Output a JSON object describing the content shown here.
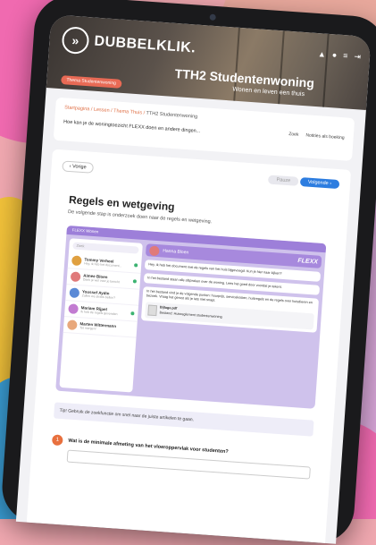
{
  "brand": {
    "name": "DUBBELKLIK."
  },
  "header": {
    "title": "TTH2 Studentenwoning",
    "subtitle": "Wonen en leven een thuis",
    "badge": "Thema Studentenwoning",
    "icons": [
      "bell-icon",
      "user-icon",
      "menu-icon",
      "logout-icon"
    ]
  },
  "breadcrumb": {
    "items": [
      "Startpagina",
      "Lessen",
      "Thema Thuis",
      "TTH2 Studentenwoning"
    ]
  },
  "lesson": {
    "question": "Hoe kan je de woningtoezicht FLEXX doen en andere dingen...",
    "actions": [
      "Zoek",
      "Notities als boeking"
    ]
  },
  "nav": {
    "prev_label": "Vorige",
    "pause_label": "Pauze",
    "next_label": "Volgende"
  },
  "section": {
    "title": "Regels en wetgeving",
    "subtitle": "De volgende stap is onderzoek doen naar de regels en wetgeving."
  },
  "app": {
    "top_label": "FLEXX Wonen",
    "search_placeholder": "Zoek",
    "brand": "FLEXX",
    "chat_name": "Hanna Bloen",
    "contacts": [
      {
        "name": "Tommy Verheel",
        "msg": "Hey, ik heb het document...",
        "color": "#e0a040"
      },
      {
        "name": "Aimee Bloen",
        "msg": "Dank je wel voor je bericht",
        "color": "#e07a7a"
      },
      {
        "name": "Youssef Aydin",
        "msg": "Zullen we straks bellen?",
        "color": "#5b8ad6"
      },
      {
        "name": "Mariam Rijpel",
        "msg": "Ik heb de regels gevonden",
        "color": "#c27bd1"
      },
      {
        "name": "Marten Wittermann",
        "msg": "Tot morgen!",
        "color": "#e8a87c"
      }
    ],
    "messages": [
      "Hey, ik heb het document met de regels van het huis bijgevoegd. Kun je hier naar kijken?",
      "In het bestand staan alle afspraken over de woning. Lees het goed door voordat je tekent.",
      "In het bestand vind je de volgende punten: huurprijs, servicekosten, huisregels en de regels over huisdieren en bezoek. Vraag het gerust als je iets niet snapt."
    ],
    "file": {
      "name": "Bijlage.pdf",
      "desc": "Bestand: Huisreglement studentenwoning"
    }
  },
  "tip": "Tip! Gebruik de zoekfunctie om snel naar de juiste artikelen te gaan.",
  "question": {
    "number": "1",
    "text": "Wat is de minimale afmeting van het vloeroppervlak voor studenten?"
  }
}
